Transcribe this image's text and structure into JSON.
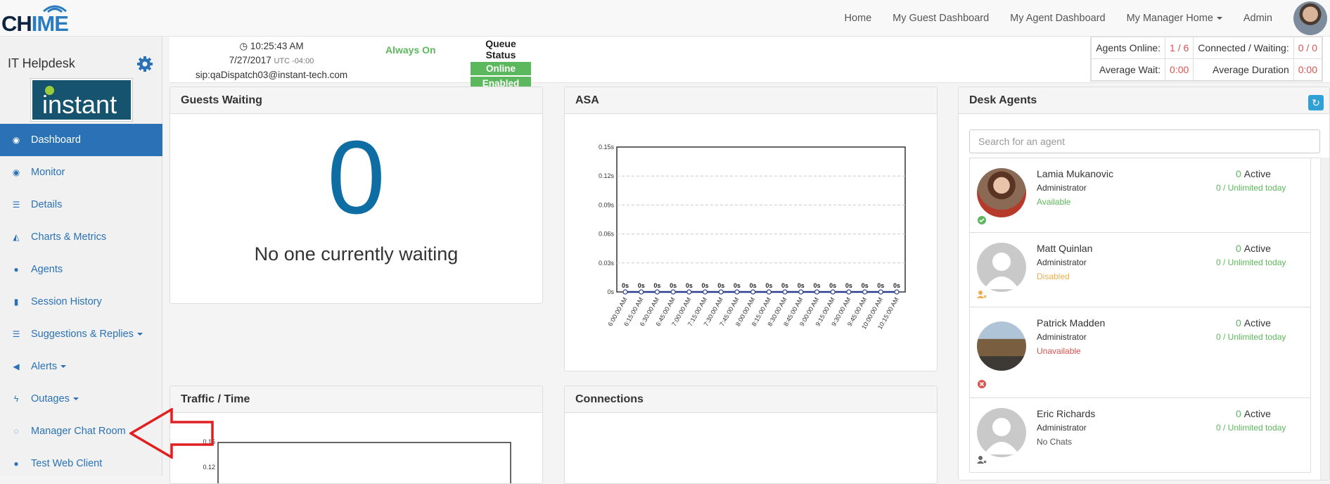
{
  "app": {
    "logo_text_a": "CH",
    "logo_text_b": "IME",
    "brand_color": "#2a72b5"
  },
  "topnav": {
    "items": [
      "Home",
      "My Guest Dashboard",
      "My Agent Dashboard",
      "My Manager Home",
      "Admin"
    ]
  },
  "sidebar": {
    "queue_name": "IT Helpdesk",
    "logo_word": "instant",
    "items": [
      {
        "label": "Dashboard",
        "icon": "dashboard-icon",
        "glyph": "◉",
        "active": true
      },
      {
        "label": "Monitor",
        "icon": "eye-icon",
        "glyph": "◉"
      },
      {
        "label": "Details",
        "icon": "list-icon",
        "glyph": "☰"
      },
      {
        "label": "Charts & Metrics",
        "icon": "area-chart-icon",
        "glyph": "◭"
      },
      {
        "label": "Agents",
        "icon": "users-icon",
        "glyph": "●"
      },
      {
        "label": "Session History",
        "icon": "book-icon",
        "glyph": "▮"
      },
      {
        "label": "Suggestions & Replies",
        "icon": "list-ol-icon",
        "glyph": "☰",
        "caret": true
      },
      {
        "label": "Alerts",
        "icon": "bullhorn-icon",
        "glyph": "◀",
        "caret": true
      },
      {
        "label": "Outages",
        "icon": "bolt-icon",
        "glyph": "ϟ",
        "caret": true
      },
      {
        "label": "Manager Chat Room",
        "icon": "comments-icon",
        "glyph": "◌"
      },
      {
        "label": "Test Web Client",
        "icon": "comment-icon",
        "glyph": "●"
      }
    ]
  },
  "status": {
    "time": "10:25:43 AM",
    "date": "7/27/2017",
    "utc": "UTC -04:00",
    "sip": "sip:qaDispatch03@instant-tech.com",
    "always_on": "Always On",
    "queue_status_title": "Queue Status",
    "queue_online": "Online",
    "queue_enabled": "Enabled",
    "agents_online_label": "Agents Online:",
    "agents_online": "1 / 6",
    "connected_waiting_label": "Connected / Waiting:",
    "connected_waiting": "0 / 0",
    "avg_wait_label": "Average Wait:",
    "avg_wait": "0:00",
    "avg_duration_label": "Average Duration",
    "avg_duration": "0:00"
  },
  "guests_waiting": {
    "title": "Guests Waiting",
    "count": "0",
    "message": "No one currently waiting"
  },
  "asa": {
    "title": "ASA"
  },
  "traffic": {
    "title": "Traffic / Time"
  },
  "connections": {
    "title": "Connections"
  },
  "desk_agents": {
    "title": "Desk Agents",
    "search_placeholder": "Search for an agent",
    "agents": [
      {
        "name": "Lamia Mukanovic",
        "role": "Administrator",
        "state": "Available",
        "state_color": "#5cb85c",
        "active": "0",
        "active_label": "Active",
        "today": "0 / Unlimited today",
        "status_icon": "check-circle-icon"
      },
      {
        "name": "Matt Quinlan",
        "role": "Administrator",
        "state": "Disabled",
        "state_color": "#f0ad4e",
        "active": "0",
        "active_label": "Active",
        "today": "0 / Unlimited today",
        "status_icon": "user-disabled-icon"
      },
      {
        "name": "Patrick Madden",
        "role": "Administrator",
        "state": "Unavailable",
        "state_color": "#d9534f",
        "active": "0",
        "active_label": "Active",
        "today": "0 / Unlimited today",
        "status_icon": "times-circle-icon"
      },
      {
        "name": "Eric Richards",
        "role": "Administrator",
        "state": "No Chats",
        "state_color": "#555555",
        "active": "0",
        "active_label": "Active",
        "today": "0 / Unlimited today",
        "status_icon": "user-no-chats-icon"
      }
    ]
  },
  "chart_data": [
    {
      "type": "line",
      "title": "",
      "xlabel": "",
      "ylabel": "",
      "categories": [
        "6:00:00 AM",
        "6:15:00 AM",
        "6:30:00 AM",
        "6:45:00 AM",
        "7:00:00 AM",
        "7:15:00 AM",
        "7:30:00 AM",
        "7:45:00 AM",
        "8:00:00 AM",
        "8:15:00 AM",
        "8:30:00 AM",
        "8:45:00 AM",
        "9:00:00 AM",
        "9:15:00 AM",
        "9:30:00 AM",
        "9:45:00 AM",
        "10:00:00 AM",
        "10:15:00 AM"
      ],
      "series": [
        {
          "values": [
            0,
            0,
            0,
            0,
            0,
            0,
            0,
            0,
            0,
            0,
            0,
            0,
            0,
            0,
            0,
            0,
            0,
            0
          ]
        }
      ],
      "data_labels": [
        "0s",
        "0s",
        "0s",
        "0s",
        "0s",
        "0s",
        "0s",
        "0s",
        "0s",
        "0s",
        "0s",
        "0s",
        "0s",
        "0s",
        "0s",
        "0s",
        "0s",
        "0s"
      ],
      "yticks": [
        "0s",
        "0.03s",
        "0.06s",
        "0.09s",
        "0.12s",
        "0.15s"
      ],
      "ylim": [
        0,
        0.15
      ],
      "grid": true
    },
    {
      "type": "line",
      "title": "",
      "yticks": [
        "0.12",
        "0.15"
      ],
      "partial": true
    }
  ]
}
